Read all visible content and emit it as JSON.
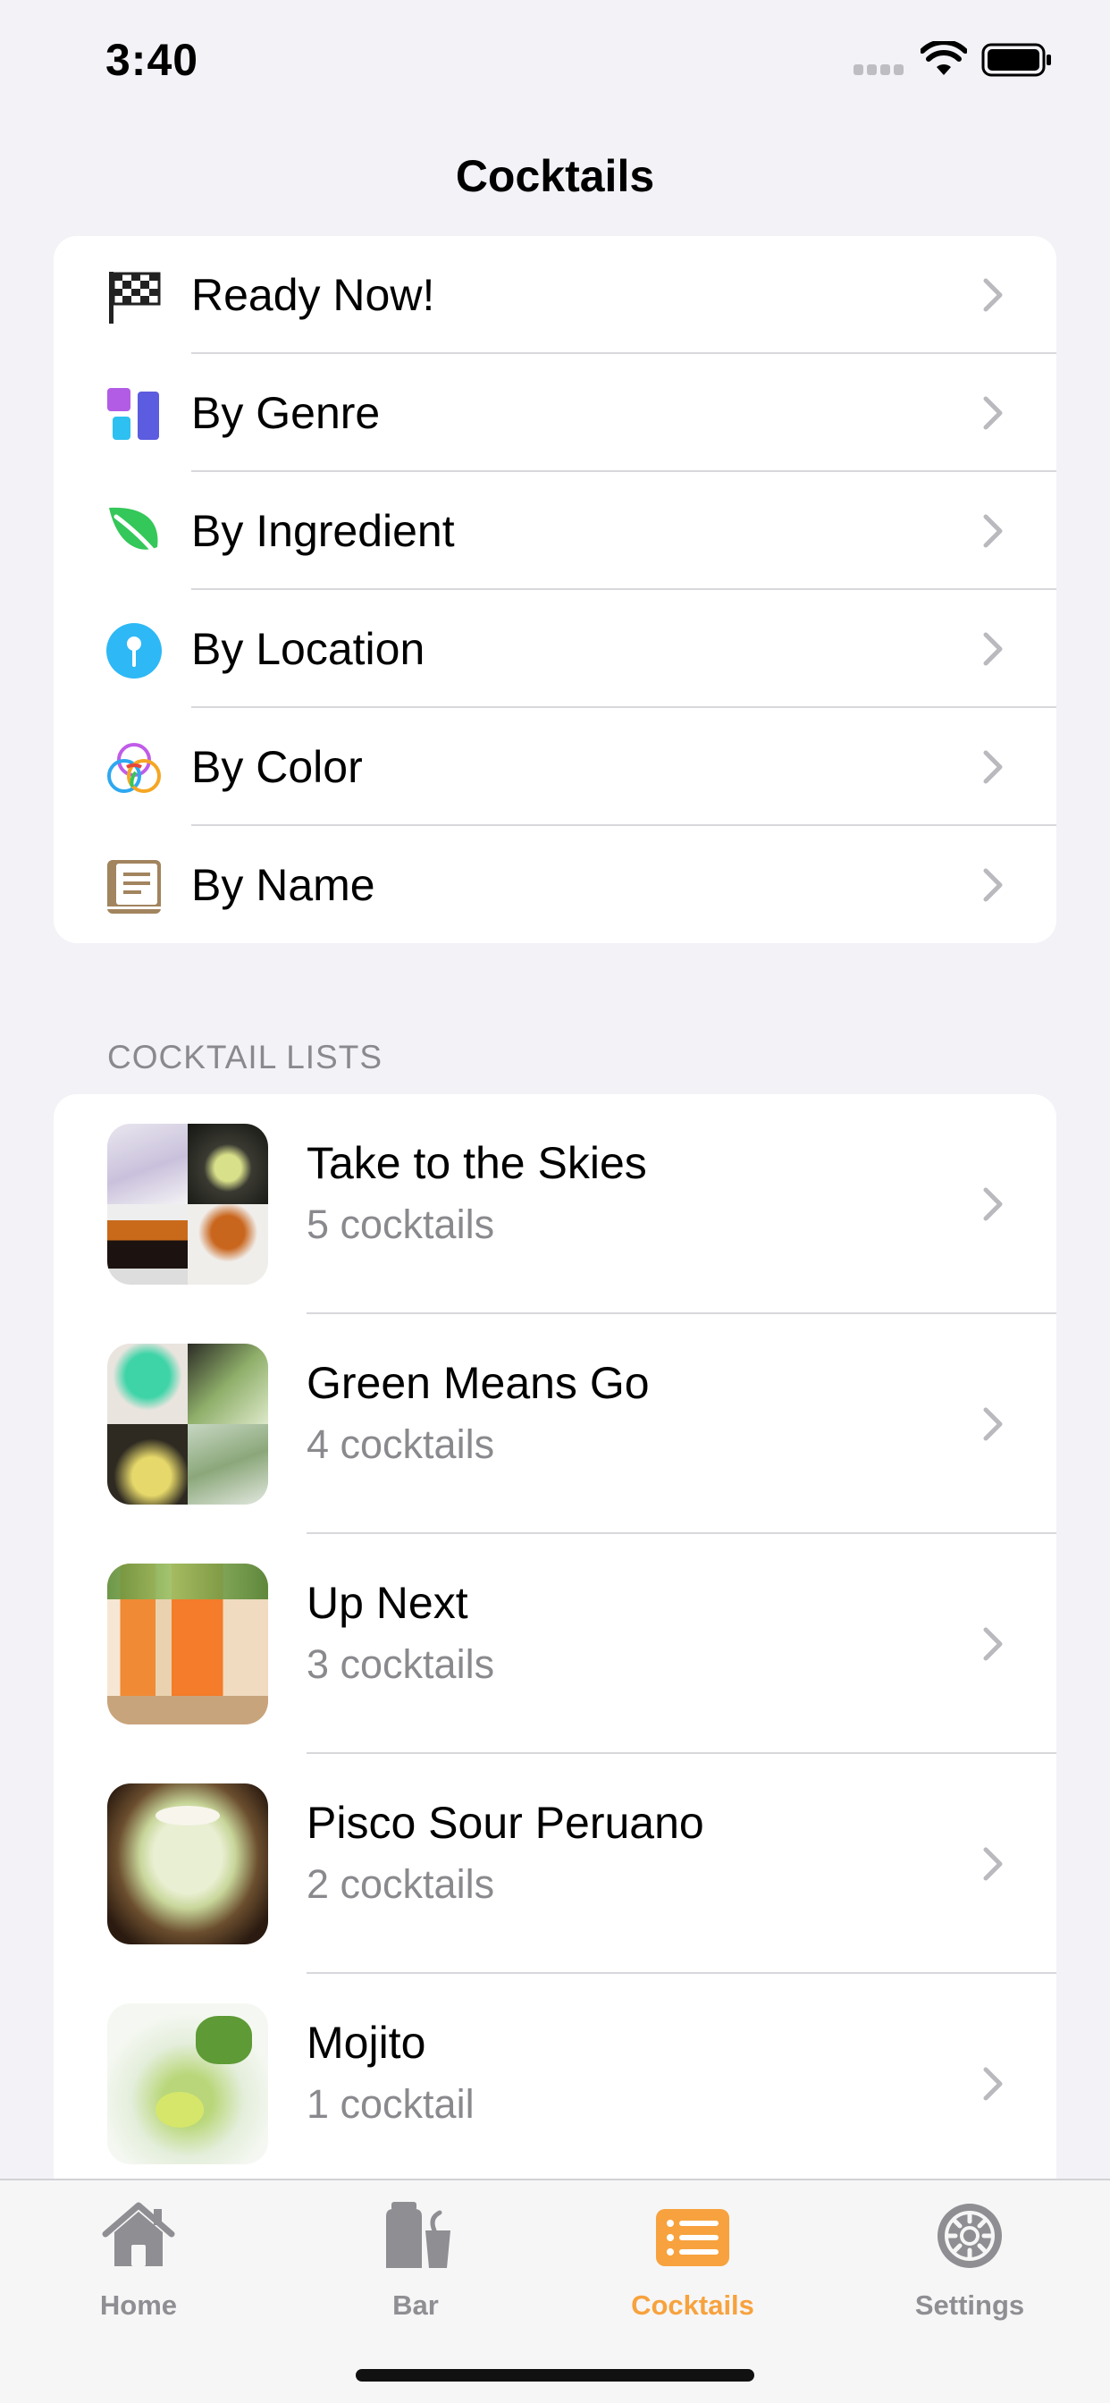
{
  "status_bar": {
    "time": "3:40"
  },
  "nav": {
    "title": "Cocktails"
  },
  "menu": {
    "items": [
      {
        "label": "Ready Now!",
        "icon": "checkered-flag-icon"
      },
      {
        "label": "By Genre",
        "icon": "genre-blocks-icon"
      },
      {
        "label": "By Ingredient",
        "icon": "leaf-icon"
      },
      {
        "label": "By Location",
        "icon": "location-pin-icon"
      },
      {
        "label": "By Color",
        "icon": "color-circles-icon"
      },
      {
        "label": "By Name",
        "icon": "book-icon"
      }
    ]
  },
  "cocktail_lists": {
    "header": "COCKTAIL LISTS",
    "items": [
      {
        "title": "Take to the Skies",
        "count": "5 cocktails"
      },
      {
        "title": "Green Means Go",
        "count": "4 cocktails"
      },
      {
        "title": "Up Next",
        "count": "3 cocktails"
      },
      {
        "title": "Pisco Sour Peruano",
        "count": "2 cocktails"
      },
      {
        "title": "Mojito",
        "count": "1 cocktail"
      }
    ]
  },
  "tab_bar": {
    "tabs": [
      {
        "label": "Home",
        "icon": "house-icon",
        "active": false
      },
      {
        "label": "Bar",
        "icon": "shaker-icon",
        "active": false
      },
      {
        "label": "Cocktails",
        "icon": "list-icon",
        "active": true
      },
      {
        "label": "Settings",
        "icon": "gear-icon",
        "active": false
      }
    ]
  },
  "colors": {
    "accent": "#F7A23E",
    "inactive": "#8E8E93",
    "background": "#F2F2F7"
  }
}
